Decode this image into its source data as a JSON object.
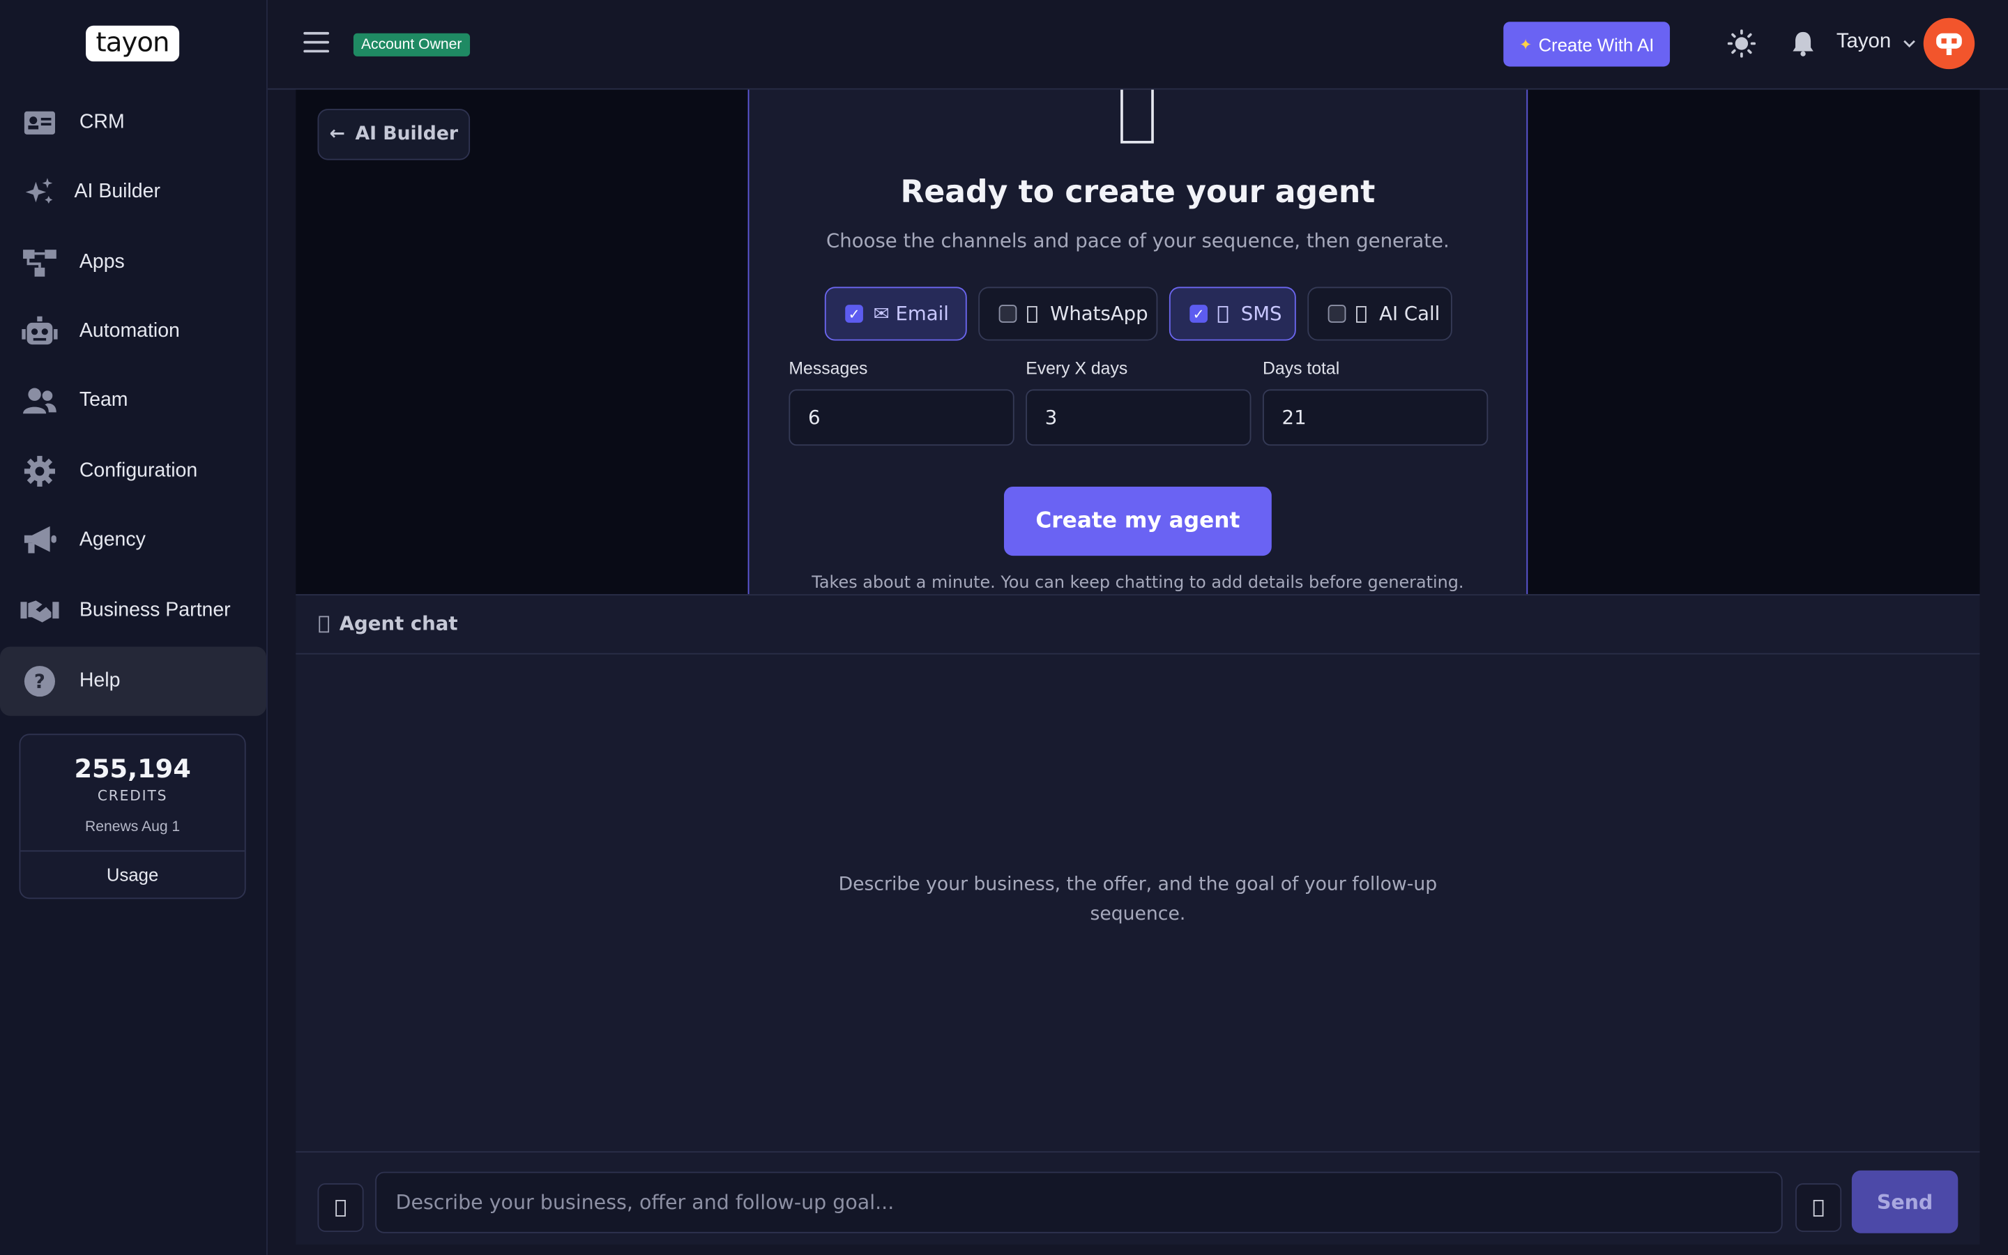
{
  "brand": {
    "logo_text": "tayon"
  },
  "sidebar": {
    "items": [
      {
        "label": "CRM",
        "icon": "id-card-icon"
      },
      {
        "label": "AI Builder",
        "icon": "sparkles-icon"
      },
      {
        "label": "Apps",
        "icon": "sitemap-icon"
      },
      {
        "label": "Automation",
        "icon": "robot-icon"
      },
      {
        "label": "Team",
        "icon": "users-icon"
      },
      {
        "label": "Configuration",
        "icon": "gear-icon"
      },
      {
        "label": "Agency",
        "icon": "megaphone-icon"
      },
      {
        "label": "Business Partner",
        "icon": "handshake-icon"
      },
      {
        "label": "Help",
        "icon": "question-circle-icon"
      }
    ],
    "active": "Help",
    "credits": {
      "amount": "255,194",
      "label": "CREDITS",
      "renews": "Renews Aug 1",
      "usage_label": "Usage"
    }
  },
  "topbar": {
    "role_badge": "Account Owner",
    "create_ai_label": "Create With AI",
    "user_name": "Tayon",
    "colors": {
      "accent": "#6a63f3",
      "badge": "#1f8a63",
      "avatar": "#f2552c"
    }
  },
  "main": {
    "back_label": "AI Builder",
    "card": {
      "title": "Ready to create your agent",
      "subtitle": "Choose the channels and pace of your sequence, then generate.",
      "channels": [
        {
          "label": "Email",
          "checked": true,
          "prefix": "✉"
        },
        {
          "label": "WhatsApp",
          "checked": false
        },
        {
          "label": "SMS",
          "checked": true
        },
        {
          "label": "AI Call",
          "checked": false
        }
      ],
      "fields": [
        {
          "label": "Messages",
          "value": "6"
        },
        {
          "label": "Every X days",
          "value": "3"
        },
        {
          "label": "Days total",
          "value": "21"
        }
      ],
      "create_label": "Create my agent",
      "note": "Takes about a minute. You can keep chatting to add details before generating."
    }
  },
  "chat": {
    "title": "Agent chat",
    "empty_text": "Describe your business, the offer, and the goal of your follow-up sequence.",
    "input_placeholder": "Describe your business, offer and follow-up goal...",
    "send_label": "Send"
  }
}
